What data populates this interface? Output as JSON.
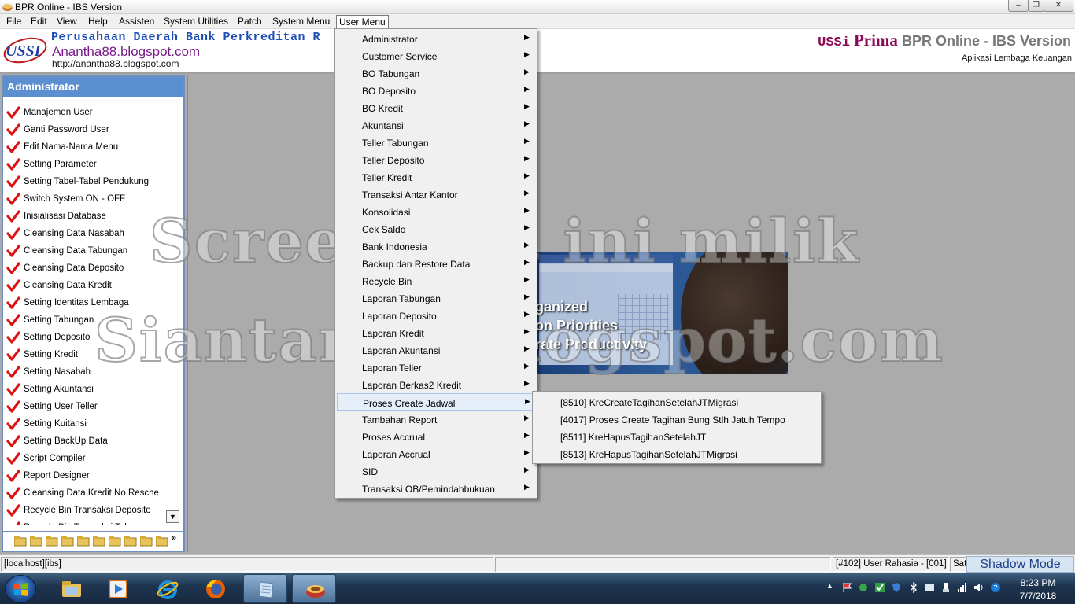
{
  "window": {
    "title": "BPR Online - IBS Version"
  },
  "menubar": {
    "items": [
      "File",
      "Edit",
      "View",
      "Help",
      "Assisten",
      "System Utilities",
      "Patch",
      "System Menu",
      "User Menu"
    ],
    "active": "User Menu"
  },
  "header": {
    "bank_name": "Perusahaan Daerah Bank Perkreditan R",
    "blog": "Anantha88.blogspot.com",
    "link": "http://anantha88.blogspot.com",
    "brand_ussi": "USSi",
    "brand_prima": "Prima",
    "brand_rest": "BPR Online - IBS Version",
    "subtitle": "Aplikasi Lembaga Keuangan",
    "logo_text": "USSI"
  },
  "sidebar": {
    "title": "Administrator",
    "items": [
      "Manajemen User",
      "Ganti Password User",
      "Edit Nama-Nama Menu",
      "Setting Parameter",
      "Setting Tabel-Tabel Pendukung",
      "Switch System ON - OFF",
      "Inisialisasi Database",
      "Cleansing Data Nasabah",
      "Cleansing Data Tabungan",
      "Cleansing Data Deposito",
      "Cleansing Data Kredit",
      "Setting Identitas Lembaga",
      "Setting Tabungan",
      "Setting Deposito",
      "Setting Kredit",
      "Setting Nasabah",
      "Setting Akuntansi",
      "Setting User Teller",
      "Setting Kuitansi",
      "Setting BackUp Data",
      "Script Compiler",
      "Report Designer",
      "Cleansing Data Kredit No Resche",
      "Recycle Bin Transaksi Deposito",
      "Recycle Bin Transaksi Tabungan"
    ],
    "item_icon": "red-check-icon",
    "more_glyph": "»"
  },
  "user_menu": {
    "items": [
      "Administrator",
      "Customer Service",
      "BO Tabungan",
      "BO Deposito",
      "BO Kredit",
      "Akuntansi",
      "Teller Tabungan",
      "Teller Deposito",
      "Teller Kredit",
      "Transaksi Antar Kantor",
      "Konsolidasi",
      "Cek Saldo",
      "Bank Indonesia",
      "Backup dan Restore Data",
      "Recycle Bin",
      "Laporan Tabungan",
      "Laporan Deposito",
      "Laporan Kredit",
      "Laporan Akuntansi",
      "Laporan Teller",
      "Laporan Berkas2 Kredit",
      "Proses Create Jadwal",
      "Tambahan Report",
      "Proses Accrual",
      "Laporan Accrual",
      "SID",
      "Transaksi OB/Pemindahbukuan"
    ],
    "highlighted": "Proses Create Jadwal",
    "submenu": [
      "[8510] KreCreateTagihanSetelahJTMigrasi",
      "[4017] Proses Create Tagihan Bung Stlh Jatuh Tempo",
      "[8511] KreHapusTagihanSetelahJT",
      "[8513] KreHapusTagihanSetelahJTMigrasi"
    ]
  },
  "splash": {
    "line1": "ganized",
    "line2": "on Priorities",
    "line3": "rate Productivity"
  },
  "watermark": {
    "line1": "Screenshot ini milik",
    "line2": "Siantarsof.blogspot.com"
  },
  "statusbar": {
    "server": "[localhost][ibs]",
    "user": "[#102] User Rahasia - [001]",
    "extra": "Satu",
    "shadow_mode": "Shadow Mode"
  },
  "taskbar": {
    "time": "8:23 PM",
    "date": "7/7/2018",
    "pinned": [
      "explorer-icon",
      "media-player-icon",
      "internet-explorer-icon",
      "firefox-icon",
      "notepad-icon",
      "ibs-app-icon"
    ]
  },
  "colors": {
    "sidebar_title": "#5b8fcf",
    "brand": "#8a0a55",
    "bank_name": "#1d4fb5",
    "blog": "#7a1a8a"
  }
}
